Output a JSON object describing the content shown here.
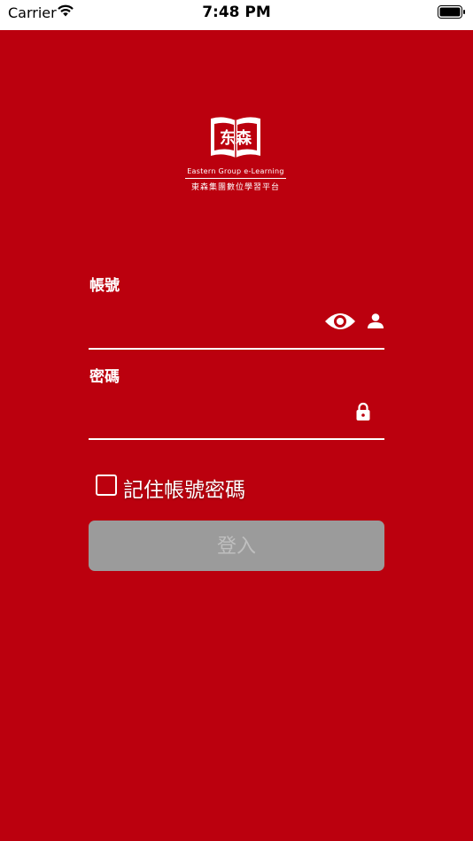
{
  "status_bar": {
    "carrier": "Carrier",
    "time": "7:48 PM",
    "wifi_icon": "wifi-icon",
    "battery_icon": "battery-icon"
  },
  "logo": {
    "emblem_text": "东森",
    "english": "Eastern Group e-Learning",
    "chinese": "東森集團數位學習平台"
  },
  "form": {
    "account_label": "帳號",
    "account_icons": [
      "eye-icon",
      "person-icon"
    ],
    "password_label": "密碼",
    "password_icon": "lock-icon",
    "remember_label": "記住帳號密碼",
    "remember_checked": false,
    "login_label": "登入"
  },
  "colors": {
    "background": "#bb000e",
    "button_disabled": "#9b9b9b",
    "button_text": "#bfbfbf",
    "foreground": "#ffffff"
  }
}
